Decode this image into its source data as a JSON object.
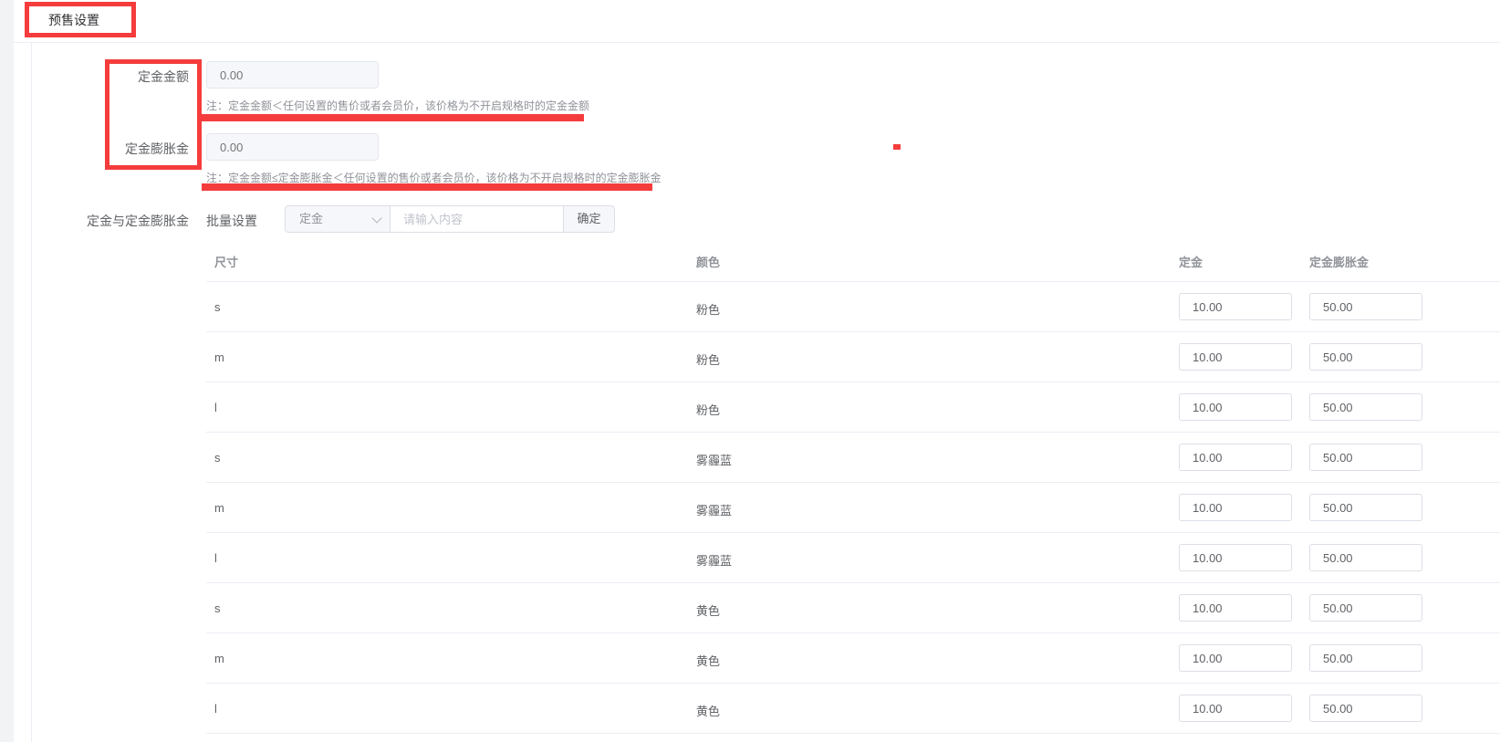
{
  "section": {
    "title": "预售设置"
  },
  "deposit": {
    "label": "定金金额",
    "placeholder": "0.00",
    "note": "注：定金金额＜任何设置的售价或者会员价，该价格为不开启规格时的定金金额"
  },
  "inflation": {
    "label": "定金膨胀金",
    "placeholder": "0.00",
    "note": "注：定金金额≤定金膨胀金＜任何设置的售价或者会员价，该价格为不开启规格时的定金膨胀金"
  },
  "spec": {
    "label": "定金与定金膨胀金",
    "batch_label": "批量设置",
    "select_value": "定金",
    "input_placeholder": "请输入内容",
    "confirm_label": "确定"
  },
  "table": {
    "headers": [
      "尺寸",
      "颜色",
      "定金",
      "定金膨胀金"
    ],
    "rows": [
      {
        "size": "s",
        "color": "粉色",
        "deposit": "10.00",
        "inflation": "50.00"
      },
      {
        "size": "m",
        "color": "粉色",
        "deposit": "10.00",
        "inflation": "50.00"
      },
      {
        "size": "l",
        "color": "粉色",
        "deposit": "10.00",
        "inflation": "50.00"
      },
      {
        "size": "s",
        "color": "雾霾蓝",
        "deposit": "10.00",
        "inflation": "50.00"
      },
      {
        "size": "m",
        "color": "雾霾蓝",
        "deposit": "10.00",
        "inflation": "50.00"
      },
      {
        "size": "l",
        "color": "雾霾蓝",
        "deposit": "10.00",
        "inflation": "50.00"
      },
      {
        "size": "s",
        "color": "黄色",
        "deposit": "10.00",
        "inflation": "50.00"
      },
      {
        "size": "m",
        "color": "黄色",
        "deposit": "10.00",
        "inflation": "50.00"
      },
      {
        "size": "l",
        "color": "黄色",
        "deposit": "10.00",
        "inflation": "50.00"
      }
    ]
  },
  "colors": {
    "annotation_red": "#f53c3c",
    "page_bg": "#f2f3f5",
    "border": "#dcdfe6"
  }
}
